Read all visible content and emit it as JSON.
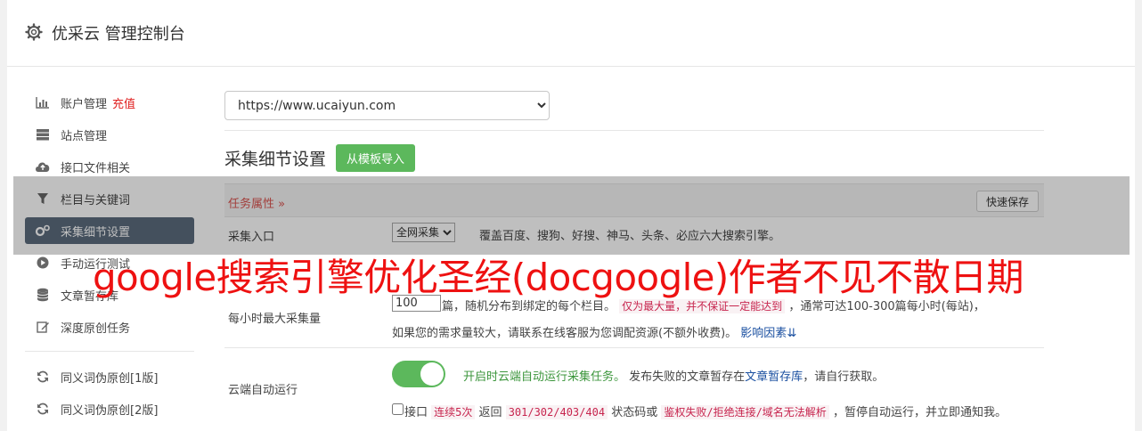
{
  "header": {
    "title": "优采云 管理控制台"
  },
  "sidebar": {
    "items": [
      {
        "label": "账户管理",
        "extra": "充值",
        "icon": "bar-chart-icon"
      },
      {
        "label": "站点管理",
        "icon": "server-icon"
      },
      {
        "label": "接口文件相关",
        "icon": "cloud-upload-icon"
      },
      {
        "label": "栏目与关键词",
        "icon": "filter-icon"
      },
      {
        "label": "采集细节设置",
        "icon": "gears-icon"
      },
      {
        "label": "手动运行测试",
        "icon": "play-icon"
      },
      {
        "label": "文章暂存库",
        "icon": "database-icon"
      },
      {
        "label": "深度原创任务",
        "icon": "edit-icon"
      },
      {
        "label": "同义词伪原创[1版]",
        "icon": "refresh-icon"
      },
      {
        "label": "同义词伪原创[2版]",
        "icon": "refresh-icon"
      }
    ]
  },
  "main": {
    "site_url": "https://www.ucaiyun.com",
    "section_title": "采集细节设置",
    "import_button": "从模板导入",
    "attr_label": "任务属性",
    "quick_save": "快速保存",
    "entry": {
      "label": "采集入口",
      "select_value": "全网采集",
      "desc": "覆盖百度、搜狗、好搜、神马、头条、必应六大搜索引擎。"
    },
    "qty": {
      "label": "每小时最大采集量",
      "value": "100",
      "line1_a": "篇，随机分布到绑定的每个栏目。",
      "line1_code": "仅为最大量，并不保证一定能达到",
      "line1_b": "，通常可达100-300篇每小时(每站)，",
      "line2_a": "如果您的需求量较大，请联系在线客服为您调配资源(不额外收费)。",
      "line2_link": "影响因素"
    },
    "auto": {
      "label": "云端自动运行",
      "desc_green": "开启时云端自动运行采集任务。",
      "desc_a": "发布失败的文章暂存在",
      "desc_link": "文章暂存库",
      "desc_b": "，请自行获取。",
      "chk_a": "接口",
      "chk_code1": "连续5次",
      "chk_b": "返回",
      "chk_code2": "301/302/403/404",
      "chk_c": "状态码或",
      "chk_code3": "鉴权失败/拒绝连接/域名无法解析",
      "chk_d": "，暂停自动运行，并立即通知我。"
    }
  },
  "overlay_text": "google搜索引擎优化圣经(docgoogle)作者不见不散日期"
}
